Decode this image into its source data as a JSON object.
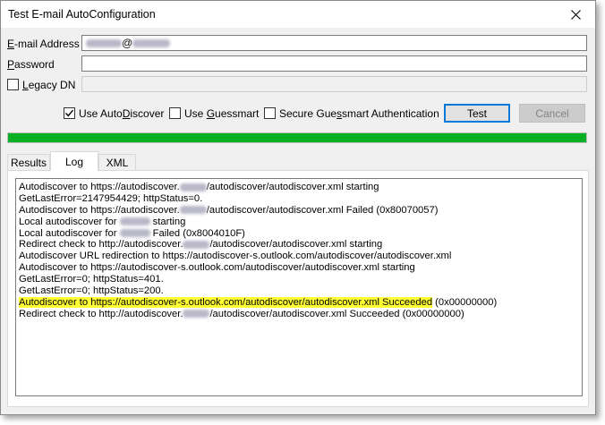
{
  "window": {
    "title": "Test E-mail AutoConfiguration"
  },
  "form": {
    "email_label_first": "E",
    "email_label_rest": "-mail Address",
    "email_value_at": "@",
    "password_label_first": "P",
    "password_label_rest": "assword",
    "password_value": "",
    "legacy_label_first": "L",
    "legacy_label_rest": "egacy DN",
    "legacy_checked": false
  },
  "options": {
    "autodiscover": {
      "pre": "Use Auto",
      "acc": "D",
      "post": "iscover",
      "checked": true
    },
    "guessmart": {
      "pre": "Use ",
      "acc": "G",
      "post": "uessmart",
      "checked": false
    },
    "secure": {
      "pre": "Secure Gue",
      "acc": "s",
      "post": "smart Authentication",
      "checked": false
    }
  },
  "buttons": {
    "test": "Test",
    "cancel": "Cancel"
  },
  "progress": {
    "value": 1.0,
    "color": "#06b025"
  },
  "tabs": [
    "Results",
    "Log",
    "XML"
  ],
  "active_tab": "Log",
  "log": [
    {
      "a": "Autodiscover to https://autodiscover.",
      "b": "/autodiscover/autodiscover.xml starting"
    },
    {
      "a": "GetLastError=2147954429; httpStatus=0.",
      "b": ""
    },
    {
      "a": "Autodiscover to https://autodiscover.",
      "b": "/autodiscover/autodiscover.xml Failed (0x80070057)"
    },
    {
      "a": "Local autodiscover for ",
      "b": " starting"
    },
    {
      "a": "Local autodiscover for ",
      "b": " Failed (0x8004010F)"
    },
    {
      "a": "Redirect check to http://autodiscover.",
      "b": "/autodiscover/autodiscover.xml starting"
    },
    {
      "a": "Autodiscover URL redirection to https://autodiscover-s.outlook.com/autodiscover/autodiscover.xml",
      "b": ""
    },
    {
      "a": "Autodiscover to https://autodiscover-s.outlook.com/autodiscover/autodiscover.xml starting",
      "b": ""
    },
    {
      "a": "GetLastError=0; httpStatus=401.",
      "b": ""
    },
    {
      "a": "GetLastError=0; httpStatus=200.",
      "b": ""
    },
    {
      "a": "Autodiscover to https://autodiscover-s.outlook.com/autodiscover/autodiscover.xml Succeeded",
      "b": " (0x00000000)"
    },
    {
      "a": "Redirect check to http://autodiscover.",
      "b": "/autodiscover/autodiscover.xml Succeeded (0x00000000)"
    }
  ],
  "colors": {
    "accent": "#0078d7",
    "highlight": "#ffff33",
    "progress": "#06b025"
  }
}
